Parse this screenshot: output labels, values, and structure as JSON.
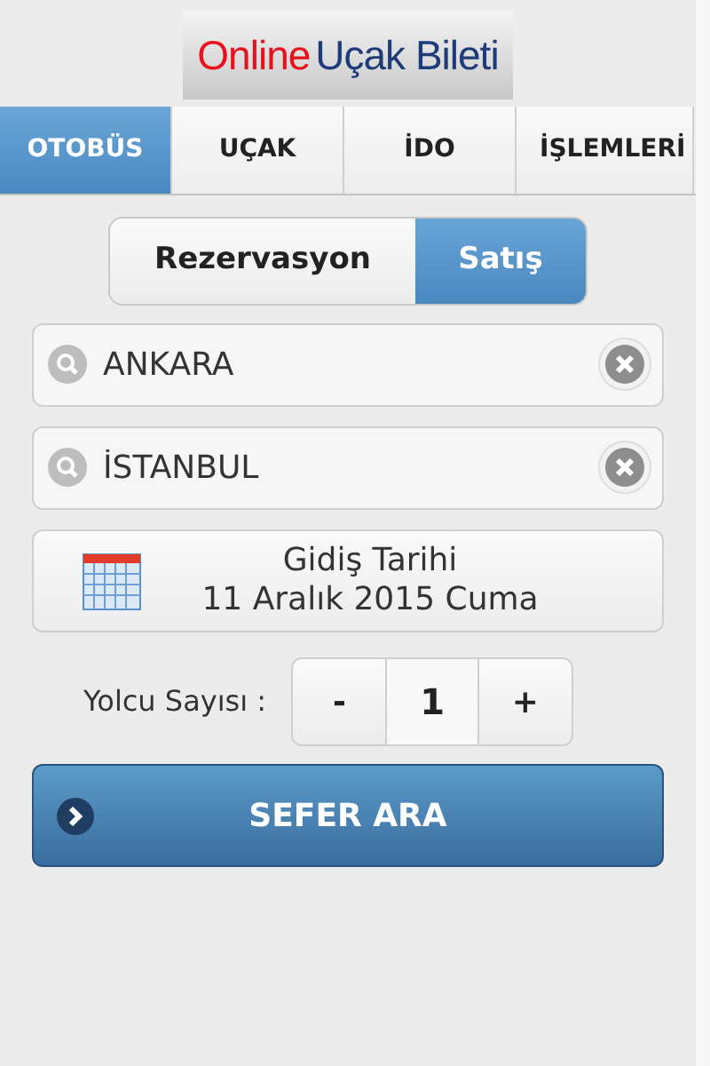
{
  "logo": {
    "part_1": "Online",
    "part_2": "Uçak Bileti"
  },
  "tabs": [
    {
      "label": "OTOBÜS",
      "selected": true
    },
    {
      "label": "UÇAK",
      "selected": false
    },
    {
      "label": "İDO",
      "selected": false
    },
    {
      "label": "İŞLEMLERİ",
      "selected": false
    }
  ],
  "mode": [
    {
      "label": "Rezervasyon",
      "selected": false
    },
    {
      "label": "Satış",
      "selected": true
    }
  ],
  "from_field": {
    "value": "ANKARA"
  },
  "to_field": {
    "value": "İSTANBUL"
  },
  "date_button": {
    "label": "Gidiş Tarihi",
    "date": "11 Aralık 2015 Cuma"
  },
  "passengers": {
    "label": "Yolcu Sayısı :",
    "minus": "-",
    "value": "1",
    "plus": "+"
  },
  "search_button": {
    "label": "SEFER ARA"
  }
}
